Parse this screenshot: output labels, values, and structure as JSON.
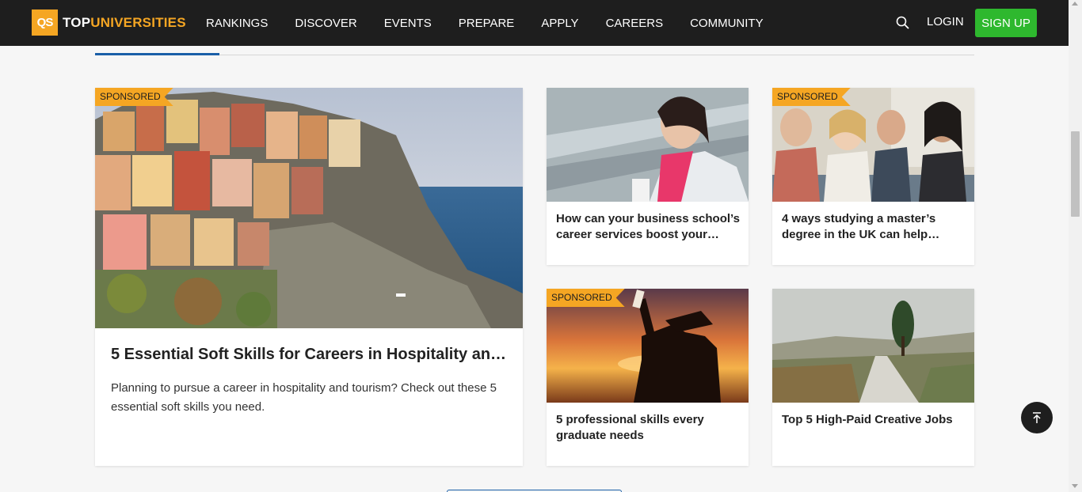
{
  "brand": {
    "logo_mark": "QS",
    "name_white": "TOP",
    "name_orange": "UNIVERSITIES"
  },
  "nav": {
    "items": [
      "RANKINGS",
      "DISCOVER",
      "EVENTS",
      "PREPARE",
      "APPLY",
      "CAREERS",
      "COMMUNITY"
    ]
  },
  "header": {
    "login": "LOGIN",
    "signup": "SIGN UP",
    "search_icon": "search-icon"
  },
  "colors": {
    "navbar": "#1e1e1e",
    "accent_orange": "#f5a623",
    "signup_green": "#2eb82e",
    "link_blue": "#1a5fa8"
  },
  "featured": {
    "badge": "SPONSORED",
    "title": "5 Essential Soft Skills for Careers in Hospitality and…",
    "description": "Planning to pursue a career in hospitality and tourism? Check out these 5 essential soft skills you need."
  },
  "articles": [
    {
      "badge": "",
      "title": "How can your business school’s career services boost your…"
    },
    {
      "badge": "SPONSORED",
      "title": "4 ways studying a master’s degree in the UK can help your…"
    },
    {
      "badge": "SPONSORED",
      "title": "5 professional skills every graduate needs"
    },
    {
      "badge": "",
      "title": "Top 5 High-Paid Creative Jobs"
    }
  ],
  "back_to_top_icon": "arrow-up-icon"
}
